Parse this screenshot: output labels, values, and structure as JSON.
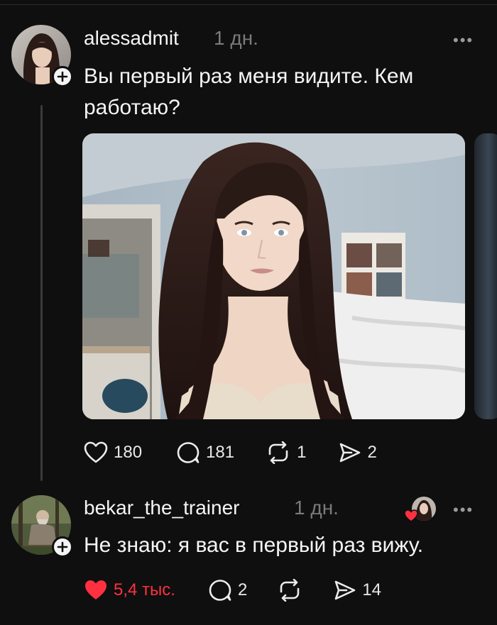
{
  "post": {
    "username": "alessadmit",
    "time": "1 дн.",
    "text_line1": "Вы первый раз меня видите. Кем",
    "text_line2": "работаю?",
    "more": "•••",
    "actions": {
      "likes": "180",
      "comments": "181",
      "reposts": "1",
      "shares": "2"
    }
  },
  "reply": {
    "username": "bekar_the_trainer",
    "time": "1 дн.",
    "text": "Не знаю: я вас в первый раз вижу.",
    "more": "•••",
    "actions": {
      "likes": "5,4 тыс.",
      "comments": "2",
      "shares": "14"
    }
  },
  "colors": {
    "background": "#0f0f0f",
    "like_active": "#ff3040",
    "muted": "#7a7a7a"
  },
  "icons": [
    "plus-icon",
    "heart-icon",
    "comment-icon",
    "repost-icon",
    "share-icon",
    "more-icon"
  ]
}
